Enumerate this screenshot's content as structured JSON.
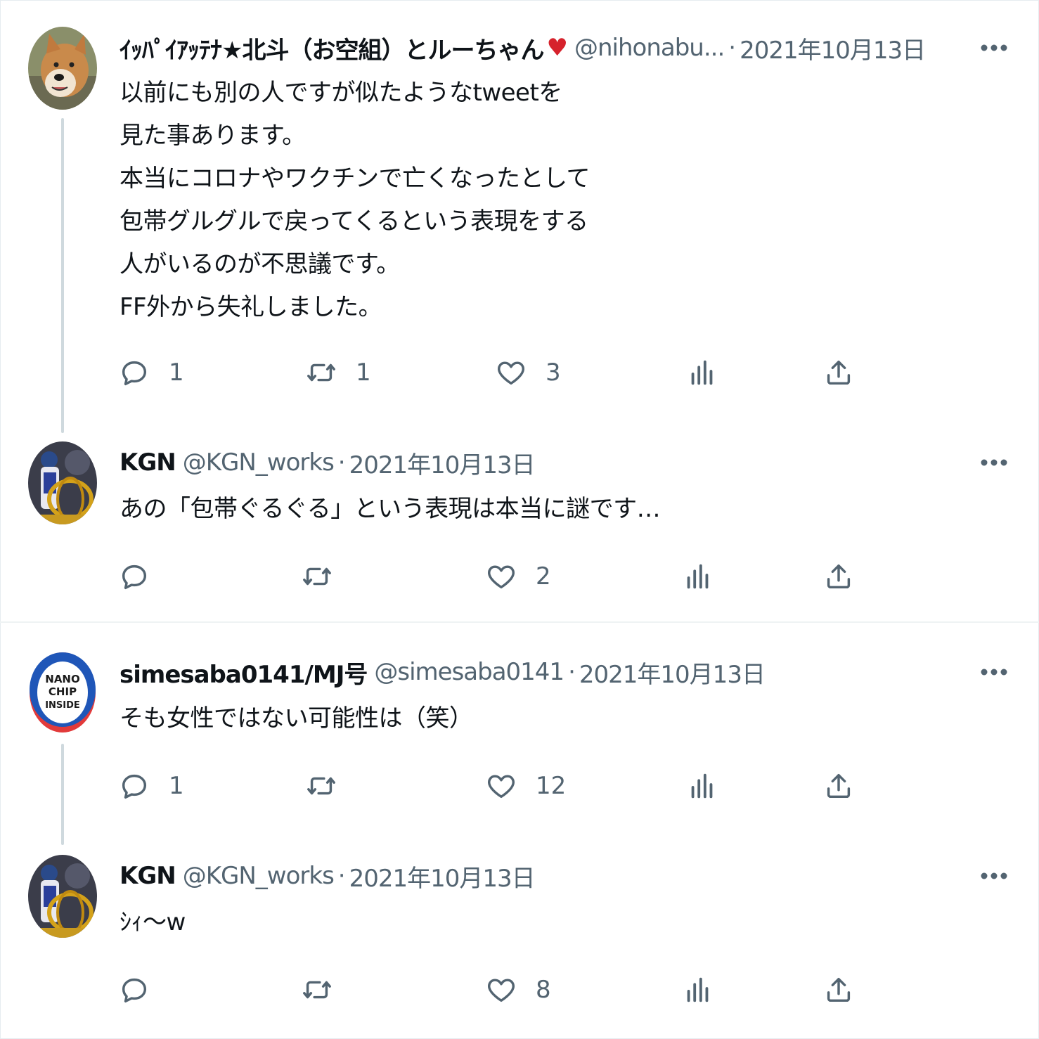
{
  "tweets": [
    {
      "display_name": "ｲｯﾊﾟｲｱｯﾃﾅ★北斗（お空組）とルーちゃん",
      "emoji": "♥",
      "handle": "@nihonabu...",
      "separator": "·",
      "date": "2021年10月13日",
      "body": [
        "以前にも別の人ですが似たようなtweetを",
        "見た事あります。",
        "本当にコロナやワクチンで亡くなったとして",
        "包帯グルグルで戻ってくるという表現をする",
        "人がいるのが不思議です。",
        "FF外から失礼しました。"
      ],
      "counts": {
        "reply": "1",
        "retweet": "1",
        "like": "3"
      }
    },
    {
      "display_name": "KGN",
      "handle": "@KGN_works",
      "separator": "·",
      "date": "2021年10月13日",
      "body": [
        "あの「包帯ぐるぐる」という表現は本当に謎です…"
      ],
      "counts": {
        "reply": "",
        "retweet": "",
        "like": "2"
      }
    },
    {
      "display_name": "simesaba0141/MJ号",
      "handle": "@simesaba0141",
      "separator": "·",
      "date": "2021年10月13日",
      "body": [
        "そも女性ではない可能性は（笑）"
      ],
      "counts": {
        "reply": "1",
        "retweet": "",
        "like": "12"
      }
    },
    {
      "display_name": "KGN",
      "handle": "@KGN_works",
      "separator": "·",
      "date": "2021年10月13日",
      "body": [
        "ｼｨ～w"
      ],
      "counts": {
        "reply": "",
        "retweet": "",
        "like": "8"
      }
    }
  ],
  "avatars": {
    "dog": "shiba-dog-avatar",
    "kgn": "figure-with-gold-ring-avatar",
    "nano": "nano-chip-inside-badge-avatar",
    "nano_text": [
      "NANO",
      "CHIP",
      "INSIDE"
    ]
  },
  "colors": {
    "text": "#0f1419",
    "secondary": "#536471",
    "thread_line": "#cfd9de",
    "heart": "#d6222c"
  }
}
